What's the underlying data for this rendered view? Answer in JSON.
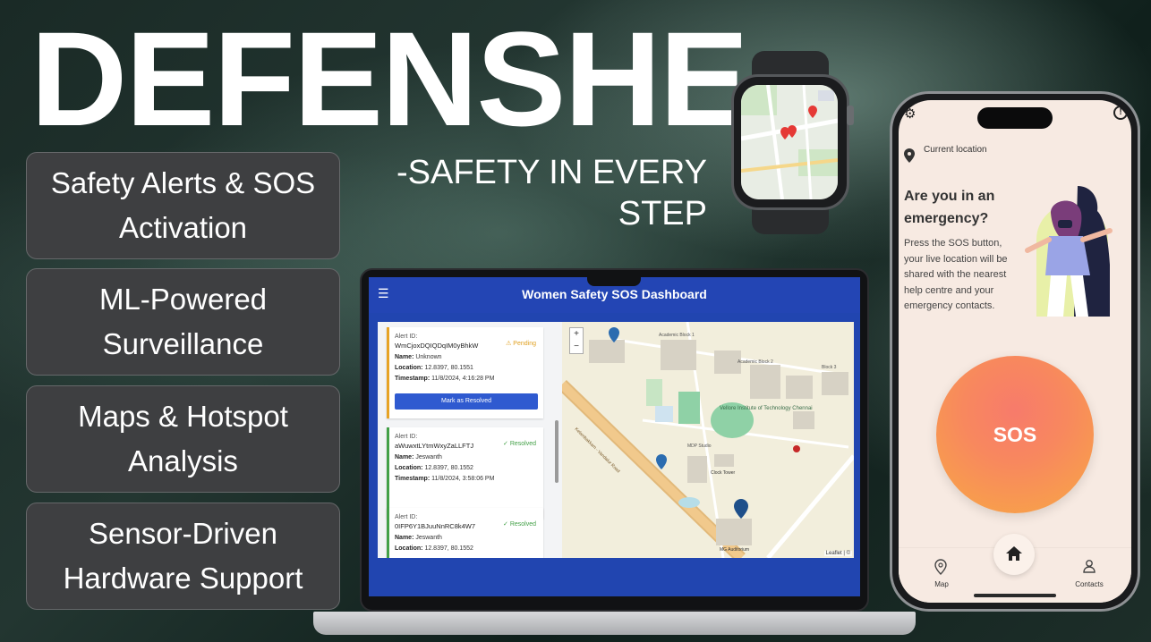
{
  "hero": {
    "title": "DEFENSHE",
    "subtitle": "-SAFETY IN EVERY STEP"
  },
  "features": [
    {
      "label": "Safety Alerts & SOS Activation"
    },
    {
      "label": "ML-Powered Surveillance"
    },
    {
      "label": "Maps & Hotspot Analysis"
    },
    {
      "label": "Sensor-Driven Hardware Support"
    }
  ],
  "dashboard": {
    "title": "Women Safety SOS Dashboard",
    "menu_icon": "menu-icon",
    "alerts": [
      {
        "id_label": "Alert ID:",
        "id": "WmCjoxDQIQDqIM0yBhkW",
        "status": "Pending",
        "name_label": "Name:",
        "name": "Unknown",
        "location_label": "Location:",
        "location": "12.8397, 80.1551",
        "timestamp_label": "Timestamp:",
        "timestamp": "11/8/2024, 4:16:28 PM",
        "action": "Mark as Resolved"
      },
      {
        "id_label": "Alert ID:",
        "id": "aWuwxtLYtmWxyZaLLFTJ",
        "status": "Resolved",
        "name_label": "Name:",
        "name": "Jeswanth",
        "location_label": "Location:",
        "location": "12.8397, 80.1552",
        "timestamp_label": "Timestamp:",
        "timestamp": "11/8/2024, 3:58:06 PM"
      },
      {
        "id_label": "Alert ID:",
        "id": "0IFP6Y1BJuuNnRC8k4W7",
        "status": "Resolved",
        "name_label": "Name:",
        "name": "Jeswanth",
        "location_label": "Location:",
        "location": "12.8397, 80.1552"
      }
    ],
    "map": {
      "zoom_in": "+",
      "zoom_out": "−",
      "labels": {
        "campus": "Vellore Institute of Technology Chennai",
        "road": "Kelambakkam - Vandalur Road",
        "auditorium": "MG Auditorium",
        "clock_tower": "Clock Tower",
        "block1": "Academic Block 1",
        "block2": "Academic Block 2",
        "block3": "Block 3",
        "mdp": "MDP Studio"
      },
      "attribution": "Leaflet | ©"
    }
  },
  "phone": {
    "location_label": "Current location",
    "question": "Are you in an emergency?",
    "description": "Press the SOS button, your live location will be shared with the nearest help centre and your emergency contacts.",
    "sos_label": "SOS",
    "info_glyph": "!",
    "nav": {
      "map_label": "Map",
      "contacts_label": "Contacts"
    },
    "colors": {
      "sos_top": "#f77b6b",
      "sos_bottom": "#f7a844",
      "background": "#f7eae2"
    }
  },
  "colors": {
    "dashboard_header": "#2345b4",
    "pending": "#e0a020",
    "resolved": "#43a047",
    "button": "#2f5ad0"
  }
}
